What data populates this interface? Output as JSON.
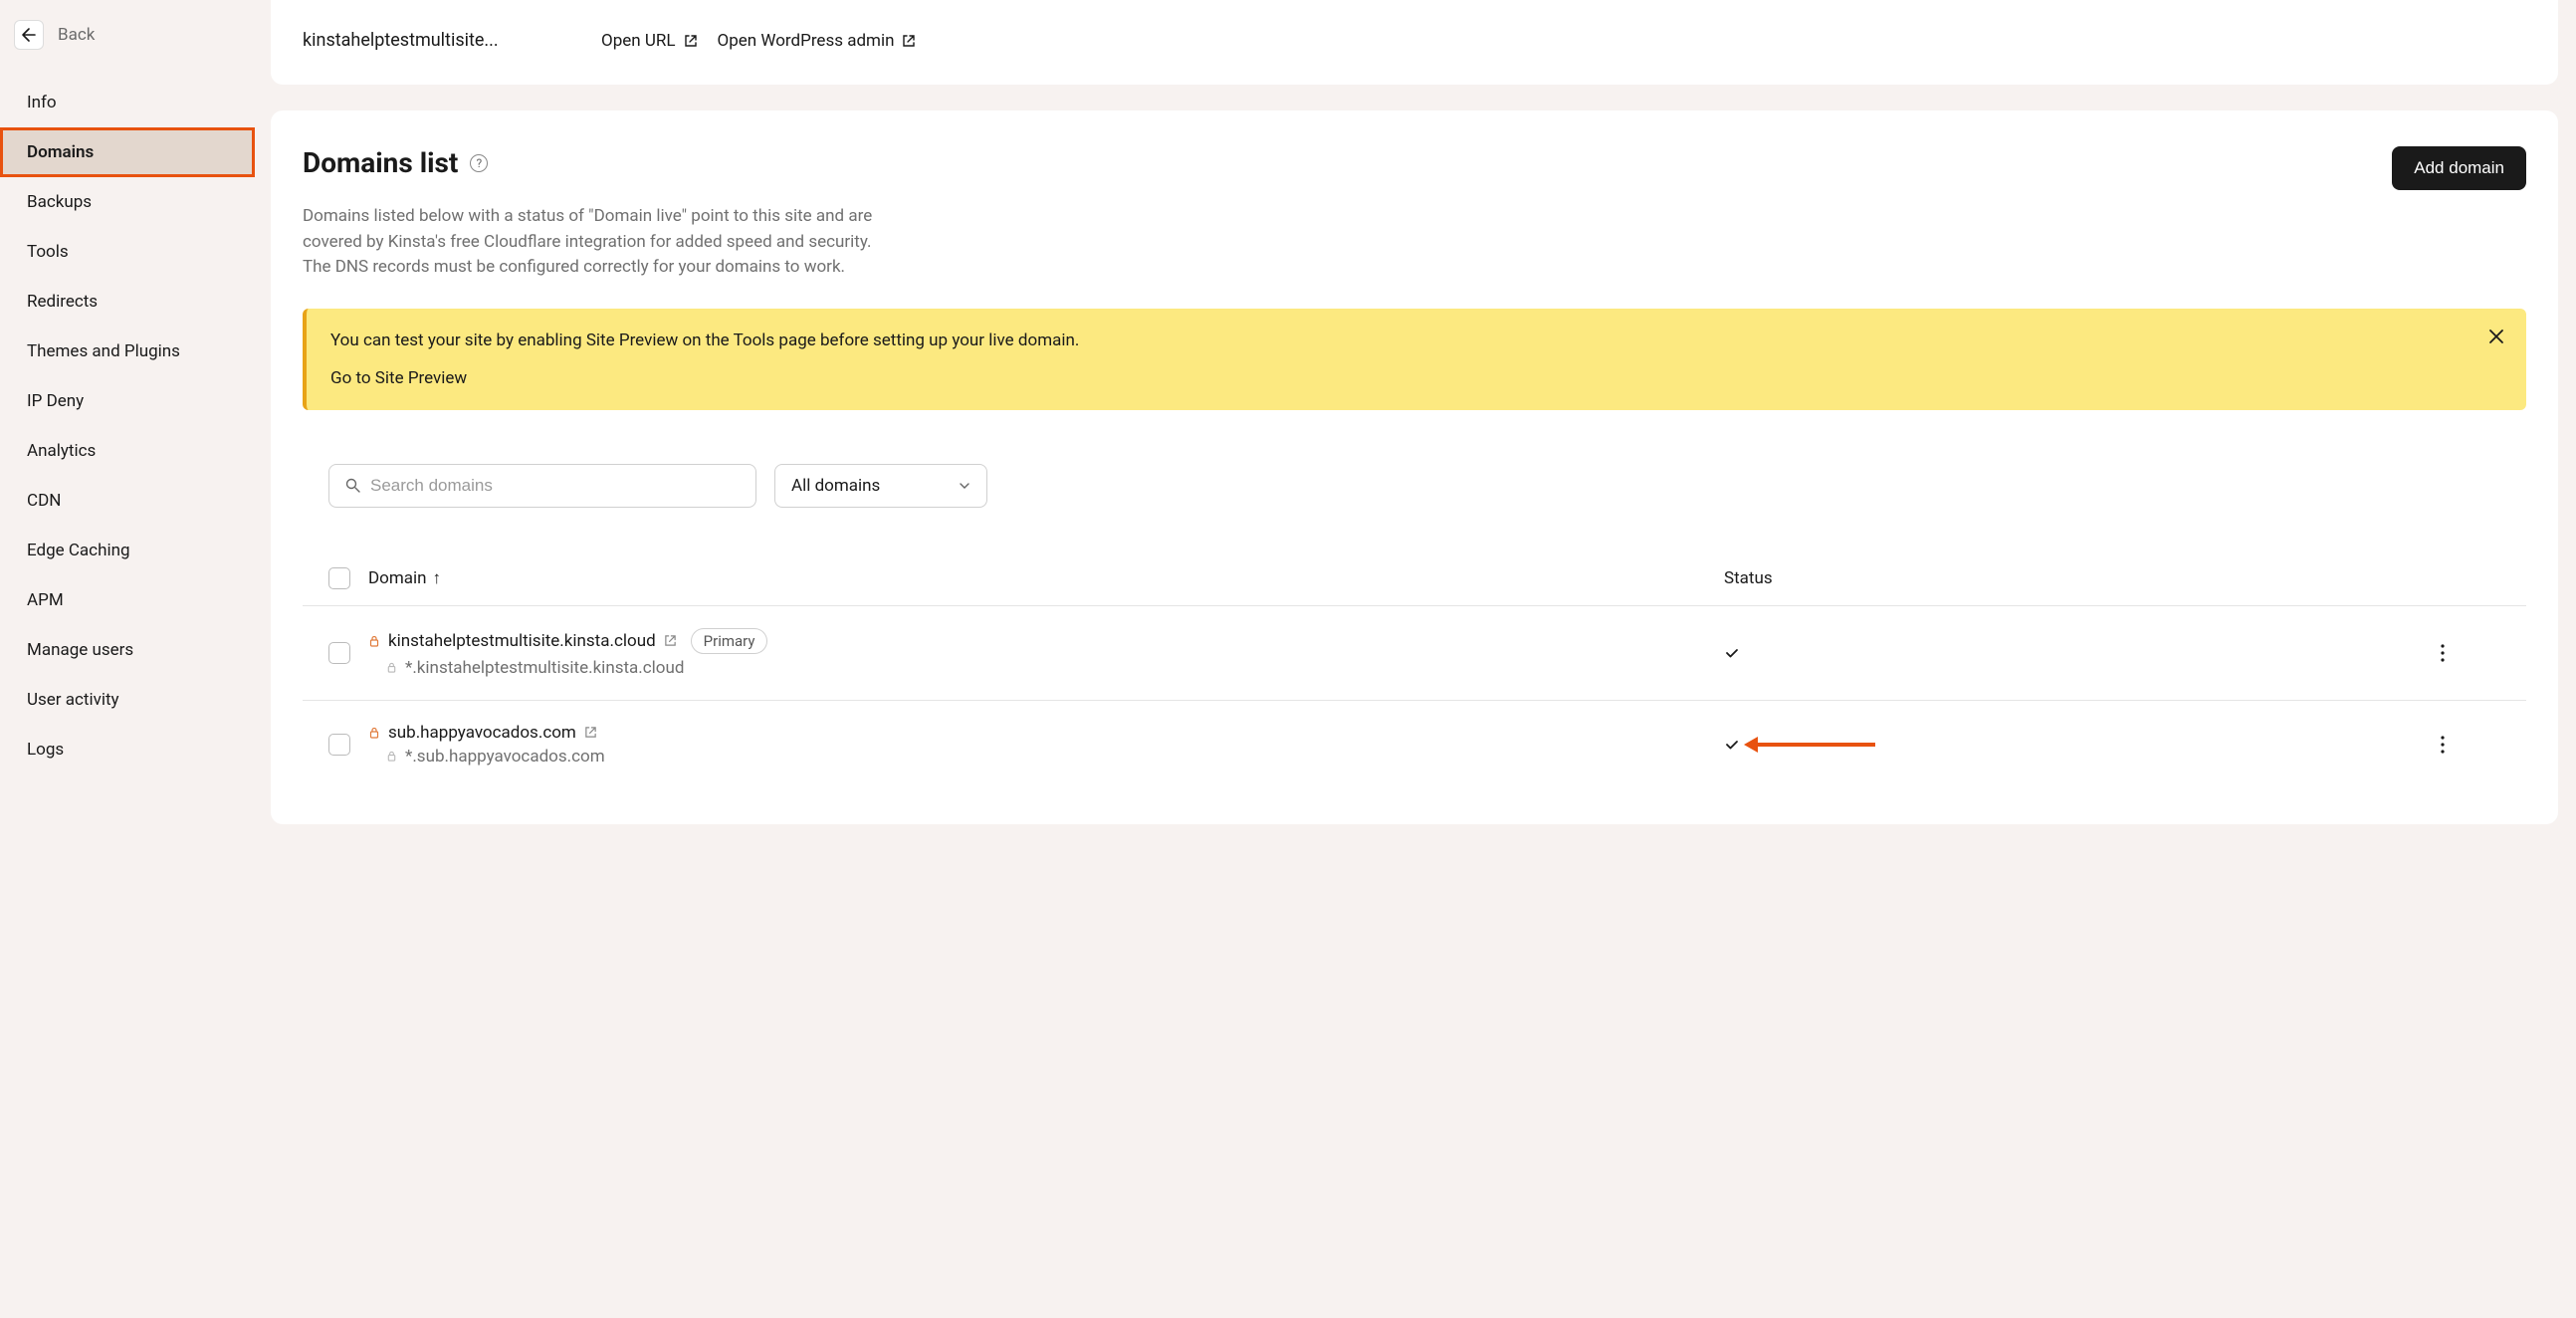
{
  "back_label": "Back",
  "sidebar": {
    "items": [
      {
        "label": "Info"
      },
      {
        "label": "Domains"
      },
      {
        "label": "Backups"
      },
      {
        "label": "Tools"
      },
      {
        "label": "Redirects"
      },
      {
        "label": "Themes and Plugins"
      },
      {
        "label": "IP Deny"
      },
      {
        "label": "Analytics"
      },
      {
        "label": "CDN"
      },
      {
        "label": "Edge Caching"
      },
      {
        "label": "APM"
      },
      {
        "label": "Manage users"
      },
      {
        "label": "User activity"
      },
      {
        "label": "Logs"
      }
    ],
    "active_index": 1
  },
  "top": {
    "site_name": "kinstahelptestmultisite...",
    "open_url": "Open URL",
    "open_admin": "Open WordPress admin"
  },
  "domains": {
    "title": "Domains list",
    "add_button": "Add domain",
    "description": "Domains listed below with a status of \"Domain live\" point to this site and are covered by Kinsta's free Cloudflare integration for added speed and security. The DNS records must be configured correctly for your domains to work.",
    "banner_text": "You can test your site by enabling Site Preview on the Tools page before setting up your live domain.",
    "banner_link": "Go to Site Preview",
    "search_placeholder": "Search domains",
    "filter_value": "All domains",
    "columns": {
      "domain": "Domain",
      "status": "Status"
    },
    "rows": [
      {
        "domain": "kinstahelptestmultisite.kinsta.cloud",
        "sub": "*.kinstahelptestmultisite.kinsta.cloud",
        "primary": true,
        "primary_badge": "Primary",
        "status_ok": true,
        "arrow": false
      },
      {
        "domain": "sub.happyavocados.com",
        "sub": "*.sub.happyavocados.com",
        "primary": false,
        "status_ok": true,
        "arrow": true
      }
    ]
  }
}
